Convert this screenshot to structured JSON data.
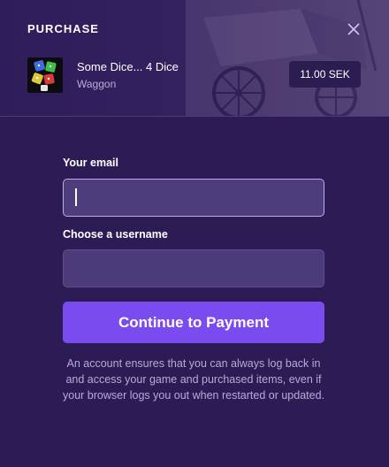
{
  "dialog": {
    "title": "PURCHASE",
    "close_icon": "close-icon"
  },
  "product": {
    "name": "Some Dice... 4 Dice",
    "developer": "Waggon",
    "price": "11.00 SEK",
    "thumbnail_icon": "dice-icon"
  },
  "form": {
    "email_label": "Your email",
    "email_value": "",
    "email_placeholder": "",
    "username_label": "Choose a username",
    "username_value": "",
    "username_placeholder": "",
    "submit_label": "Continue to Payment",
    "note": "An account ensures that you can always log back in and access your game and purchased items, even if your browser logs you out when restarted or updated."
  },
  "colors": {
    "background": "#2c1b55",
    "input": "#4b3b7a",
    "accent": "#7a4cf0",
    "muted_text": "#b7acd5"
  }
}
